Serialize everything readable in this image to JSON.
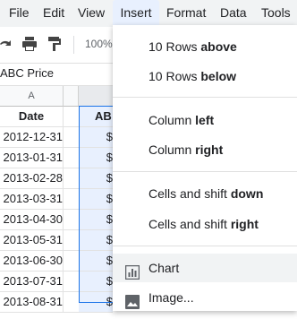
{
  "menubar": {
    "items": [
      "File",
      "Edit",
      "View",
      "Insert",
      "Format",
      "Data",
      "Tools"
    ],
    "active": "Insert"
  },
  "toolbar": {
    "zoom": "100%"
  },
  "formula": {
    "text": "ABC Price"
  },
  "grid": {
    "col_a": "A",
    "header_date": "Date",
    "header_b": "AB",
    "rows": [
      {
        "date": "2012-12-31",
        "b": "$"
      },
      {
        "date": "2013-01-31",
        "b": "$"
      },
      {
        "date": "2013-02-28",
        "b": "$"
      },
      {
        "date": "2013-03-31",
        "b": "$"
      },
      {
        "date": "2013-04-30",
        "b": "$"
      },
      {
        "date": "2013-05-31",
        "b": "$"
      },
      {
        "date": "2013-06-30",
        "b": "$"
      },
      {
        "date": "2013-07-31",
        "b": "$"
      },
      {
        "date": "2013-08-31",
        "b": "$"
      }
    ]
  },
  "insert_menu": {
    "rows_above_prefix": "10 Rows ",
    "rows_above_bold": "above",
    "rows_below_prefix": "10 Rows ",
    "rows_below_bold": "below",
    "col_left_prefix": "Column ",
    "col_left_bold": "left",
    "col_right_prefix": "Column ",
    "col_right_bold": "right",
    "cells_down_prefix": "Cells and shift ",
    "cells_down_bold": "down",
    "cells_right_prefix": "Cells and shift ",
    "cells_right_bold": "right",
    "chart": "Chart",
    "image": "Image..."
  },
  "colors": {
    "accent": "#1a73e8",
    "selection": "#e8f0fe",
    "menubar": "#f1f3f4"
  }
}
